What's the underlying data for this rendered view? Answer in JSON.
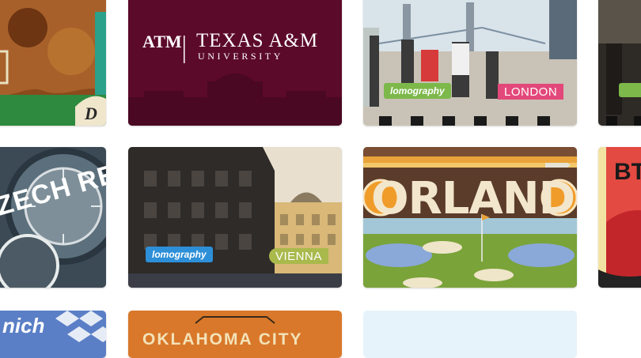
{
  "cards": {
    "disney": {
      "badge": "D"
    },
    "texas_am": {
      "logo_text": "ATM",
      "title": "TEXAS A&M",
      "subtitle": "UNIVERSITY"
    },
    "london": {
      "brand": "lomography",
      "city": "LONDON"
    },
    "czech": {
      "text": "ZECH REPU"
    },
    "vienna": {
      "brand": "lomography",
      "city": "VIENNA"
    },
    "orlando": {
      "title": "ORLANDO"
    },
    "right_mid": {
      "text": "BT"
    },
    "munich": {
      "text": "nich"
    },
    "okc": {
      "title": "OKLAHOMA CITY"
    }
  },
  "colors": {
    "maroon": "#5c0a2a",
    "lomo_green": "#7db84a",
    "lomo_blue": "#2d8fd8",
    "london_pink": "#e3487a",
    "vienna_olive": "#a9b94c"
  }
}
